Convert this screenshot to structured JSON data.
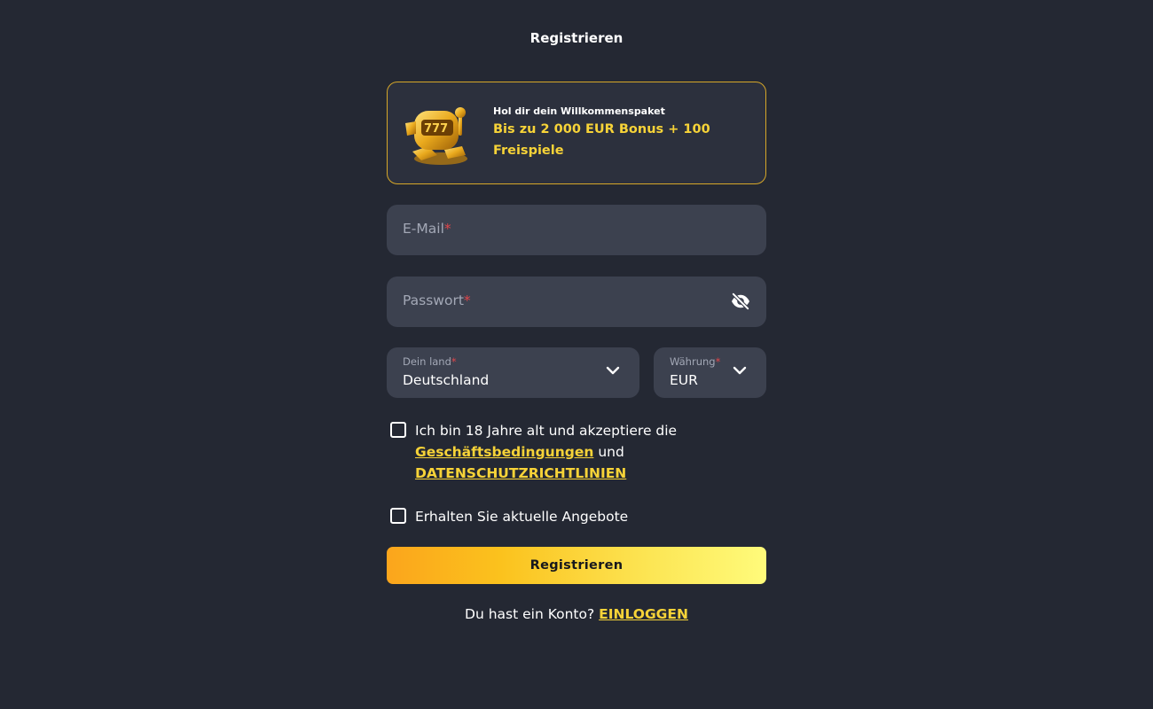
{
  "header": {
    "title": "Registrieren"
  },
  "promo": {
    "art_icon": "golden-slot-machine-icon",
    "subtitle": "Hol dir dein Willkommenspaket",
    "offer_line1": "Bis zu 2 000 EUR Bonus + 100",
    "offer_line2": "Freispiele"
  },
  "form": {
    "email": {
      "placeholder": "E-Mail",
      "required_mark": "*",
      "value": ""
    },
    "password": {
      "placeholder": "Passwort",
      "required_mark": "*",
      "value": "",
      "toggle_icon": "eye-slash-icon"
    },
    "country": {
      "label": "Dein land",
      "required_mark": "*",
      "value": "Deutschland",
      "icon": "chevron-down-icon"
    },
    "currency": {
      "label": "Währung",
      "required_mark": "*",
      "value": "EUR",
      "icon": "chevron-down-icon"
    },
    "terms": {
      "checked": false,
      "text_before": "Ich bin 18 Jahre alt und akzeptiere die",
      "terms_link": "Geschäftsbedingungen",
      "text_between": " und",
      "privacy_link": "DATENSCHUTZRICHTLINIEN"
    },
    "offers": {
      "checked": false,
      "text": "Erhalten Sie aktuelle Angebote"
    },
    "submit_label": "Registrieren"
  },
  "footer": {
    "prompt": "Du hast ein Konto? ",
    "login_link": "EINLOGGEN"
  },
  "colors": {
    "background": "#242833",
    "field": "#3c414f",
    "accent_yellow": "#f7d338",
    "promo_border": "#d6a728",
    "required": "#e0454a"
  }
}
